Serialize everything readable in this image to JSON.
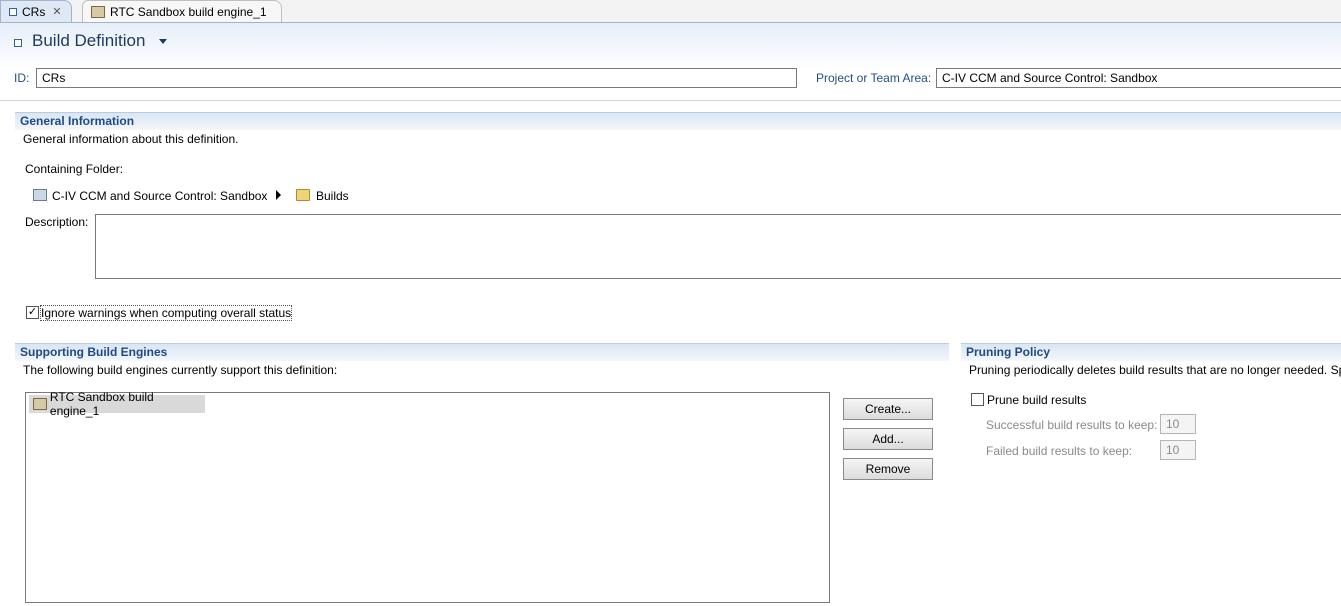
{
  "tabs": [
    {
      "label": "CRs",
      "active": true
    },
    {
      "label": "RTC Sandbox build engine_1",
      "active": false
    }
  ],
  "header": {
    "title": "Build Definition",
    "id_label": "ID:",
    "id_value": "CRs",
    "project_label": "Project or Team Area:",
    "project_value": "C-IV CCM and Source Control: Sandbox"
  },
  "general": {
    "title": "General Information",
    "desc": "General information about this definition.",
    "containing_folder_label": "Containing Folder:",
    "folder_path": [
      "C-IV CCM and Source Control: Sandbox",
      "Builds"
    ],
    "description_label": "Description:",
    "description_value": "",
    "ignore_warnings_label": "Ignore warnings when computing overall status",
    "ignore_warnings_checked": true
  },
  "engines": {
    "title": "Supporting Build Engines",
    "desc": "The following build engines currently support this definition:",
    "items": [
      "RTC Sandbox build engine_1"
    ],
    "create_label": "Create...",
    "add_label": "Add...",
    "remove_label": "Remove"
  },
  "pruning": {
    "title": "Pruning Policy",
    "desc": "Pruning periodically deletes build results that are no longer needed. Sp",
    "prune_label": "Prune build results",
    "prune_checked": false,
    "successful_label": "Successful build results to keep:",
    "successful_value": "10",
    "failed_label": "Failed build results to keep:",
    "failed_value": "10"
  }
}
